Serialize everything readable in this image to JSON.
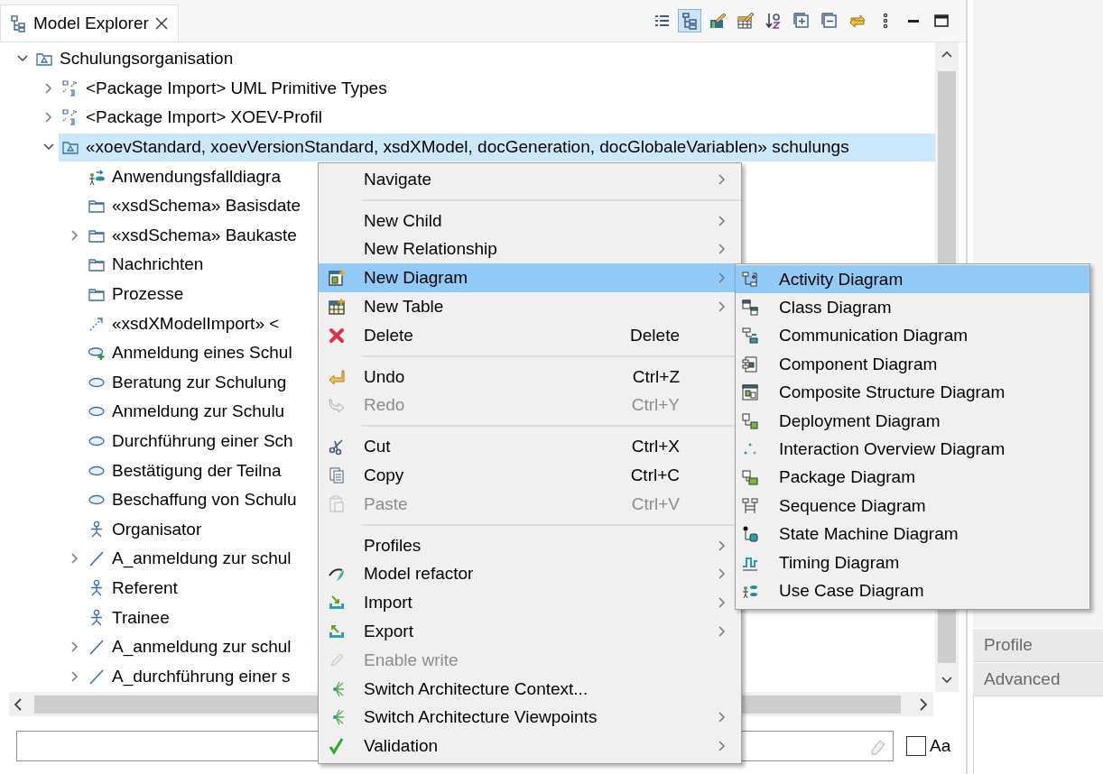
{
  "view": {
    "title": "Model Explorer"
  },
  "toolbar": [
    {
      "pressed": false
    },
    {
      "pressed": true
    },
    {
      "pressed": false
    },
    {
      "pressed": false
    },
    {
      "pressed": false
    },
    {
      "pressed": false
    },
    {
      "pressed": false
    },
    {
      "pressed": false
    },
    {
      "pressed": false
    },
    {
      "pressed": false
    },
    {
      "pressed": false
    }
  ],
  "tree": [
    {
      "label": "Schulungsorganisation",
      "kind": "package",
      "expanded": true,
      "selected": false,
      "children": [
        {
          "label": "<Package Import> UML Primitive Types",
          "kind": "packageimport",
          "expanded": false,
          "selected": false
        },
        {
          "label": "<Package Import> XOEV-Profil",
          "kind": "packageimport",
          "expanded": false,
          "selected": false
        },
        {
          "label": "«xoevStandard, xoevVersionStandard, xsdXModel, docGeneration, docGlobaleVariablen» schulungs",
          "kind": "package",
          "expanded": true,
          "selected": true,
          "children": [
            {
              "label": "Anwendungsfalldiagra",
              "kind": "diagram",
              "selected": false
            },
            {
              "label": "«xsdSchema» Basisdate",
              "kind": "folder",
              "selected": false
            },
            {
              "label": "«xsdSchema» Baukaste",
              "kind": "folder",
              "expanded": false,
              "selected": false
            },
            {
              "label": "Nachrichten",
              "kind": "folder",
              "selected": false
            },
            {
              "label": "Prozesse",
              "kind": "folder",
              "selected": false
            },
            {
              "label": "«xsdXModelImport» <",
              "kind": "dependency",
              "selected": false
            },
            {
              "label": "Anmeldung eines Schul",
              "kind": "usecaseadd",
              "selected": false
            },
            {
              "label": "Beratung zur Schulung",
              "kind": "usecase",
              "selected": false
            },
            {
              "label": "Anmeldung zur Schulu",
              "kind": "usecase",
              "selected": false
            },
            {
              "label": "Durchführung einer Sch",
              "kind": "usecase",
              "selected": false
            },
            {
              "label": "Bestätigung der Teilna",
              "kind": "usecase",
              "selected": false
            },
            {
              "label": "Beschaffung von Schulu",
              "kind": "usecase",
              "selected": false
            },
            {
              "label": "Organisator",
              "kind": "actor",
              "selected": false
            },
            {
              "label": "A_anmeldung zur schul",
              "kind": "association",
              "expanded": false,
              "selected": false
            },
            {
              "label": "Referent",
              "kind": "actor",
              "selected": false
            },
            {
              "label": "Trainee",
              "kind": "actor",
              "selected": false
            },
            {
              "label": "A_anmeldung zur schul",
              "kind": "association",
              "expanded": false,
              "selected": false
            },
            {
              "label": "A_durchführung einer s",
              "kind": "association",
              "expanded": false,
              "selected": false
            }
          ]
        }
      ]
    }
  ],
  "filter": {
    "match_case": {
      "label": "Aa",
      "checked": false
    }
  },
  "side_tabs": [
    {
      "label": "Profile",
      "selected": false
    },
    {
      "label": "Advanced",
      "selected": false
    }
  ],
  "context_menu": [
    {
      "kind": "plain",
      "label": "Navigate",
      "submenu": true,
      "disabled": false,
      "selected": false
    },
    {
      "kind": "separator"
    },
    {
      "kind": "plain",
      "label": "New Child",
      "submenu": true,
      "disabled": false,
      "selected": false
    },
    {
      "kind": "plain",
      "label": "New Relationship",
      "submenu": true,
      "disabled": false,
      "selected": false
    },
    {
      "kind": "diagram",
      "label": "New Diagram",
      "submenu": true,
      "disabled": false,
      "selected": true
    },
    {
      "kind": "table",
      "label": "New Table",
      "submenu": true,
      "disabled": false,
      "selected": false
    },
    {
      "kind": "delete",
      "label": "Delete",
      "shortcut": "Delete",
      "submenu": false,
      "disabled": false,
      "selected": false
    },
    {
      "kind": "separator"
    },
    {
      "kind": "undo",
      "label": "Undo",
      "shortcut": "Ctrl+Z",
      "submenu": false,
      "disabled": false,
      "selected": false
    },
    {
      "kind": "redo",
      "label": "Redo",
      "shortcut": "Ctrl+Y",
      "submenu": false,
      "disabled": true,
      "selected": false
    },
    {
      "kind": "separator"
    },
    {
      "kind": "cut",
      "label": "Cut",
      "shortcut": "Ctrl+X",
      "submenu": false,
      "disabled": false,
      "selected": false
    },
    {
      "kind": "copy",
      "label": "Copy",
      "shortcut": "Ctrl+C",
      "submenu": false,
      "disabled": false,
      "selected": false
    },
    {
      "kind": "paste",
      "label": "Paste",
      "shortcut": "Ctrl+V",
      "submenu": false,
      "disabled": true,
      "selected": false
    },
    {
      "kind": "separator"
    },
    {
      "kind": "plain",
      "label": "Profiles",
      "submenu": true,
      "disabled": false,
      "selected": false
    },
    {
      "kind": "refactor",
      "label": "Model refactor",
      "submenu": true,
      "disabled": false,
      "selected": false
    },
    {
      "kind": "import",
      "label": "Import",
      "submenu": true,
      "disabled": false,
      "selected": false
    },
    {
      "kind": "export",
      "label": "Export",
      "submenu": true,
      "disabled": false,
      "selected": false
    },
    {
      "kind": "pencil",
      "label": "Enable write",
      "submenu": false,
      "disabled": true,
      "selected": false
    },
    {
      "kind": "switch",
      "label": "Switch Architecture Context...",
      "submenu": false,
      "disabled": false,
      "selected": false
    },
    {
      "kind": "switch",
      "label": "Switch Architecture Viewpoints",
      "submenu": true,
      "disabled": false,
      "selected": false
    },
    {
      "kind": "check",
      "label": "Validation",
      "submenu": true,
      "disabled": false,
      "selected": false
    }
  ],
  "diagram_submenu": [
    {
      "kind": "activity",
      "label": "Activity Diagram",
      "selected": true
    },
    {
      "kind": "class",
      "label": "Class Diagram",
      "selected": false
    },
    {
      "kind": "communication",
      "label": "Communication Diagram",
      "selected": false
    },
    {
      "kind": "component",
      "label": "Component Diagram",
      "selected": false
    },
    {
      "kind": "composite",
      "label": "Composite Structure Diagram",
      "selected": false
    },
    {
      "kind": "deployment",
      "label": "Deployment Diagram",
      "selected": false
    },
    {
      "kind": "interaction",
      "label": "Interaction Overview Diagram",
      "selected": false
    },
    {
      "kind": "package",
      "label": "Package Diagram",
      "selected": false
    },
    {
      "kind": "sequence",
      "label": "Sequence Diagram",
      "selected": false
    },
    {
      "kind": "statemachine",
      "label": "State Machine Diagram",
      "selected": false
    },
    {
      "kind": "timing",
      "label": "Timing Diagram",
      "selected": false
    },
    {
      "kind": "usecase",
      "label": "Use Case Diagram",
      "selected": false
    }
  ]
}
